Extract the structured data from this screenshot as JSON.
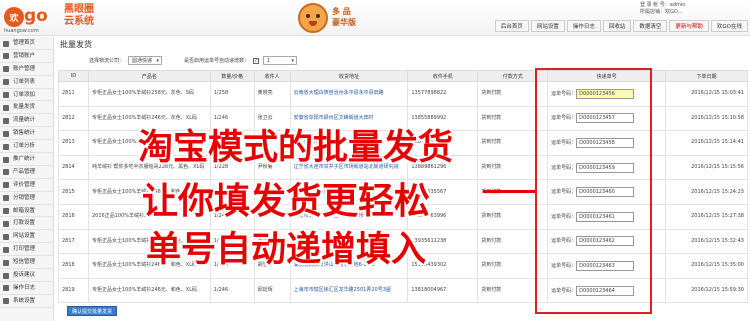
{
  "header": {
    "logo_text": "go",
    "logo_circle": "欢",
    "logo_url": "huangow.com",
    "brand_line1": "黑眼圈",
    "brand_line2": "云系统",
    "edition_line1": "多 品",
    "edition_line2": "豪华版",
    "user_line1": "登 录 帐 号：admin",
    "user_line2": "所属店铺：欢GO...",
    "nav": [
      "后台首页",
      "网站设置",
      "操作日志",
      "回收站",
      "数据清空",
      "更新与帮助",
      "欢GO在线"
    ],
    "nav_active_index": 5
  },
  "sidebar": {
    "items": [
      "管理首页",
      "营销账户",
      "账户管理",
      "订单列表",
      "订单添加",
      "批量发货",
      "流量统计",
      "销售统计",
      "订单分析",
      "推广统计",
      "产品管理",
      "评价管理",
      "分销管理",
      "邮箱设置",
      "打款设置",
      "网站设置",
      "打印管理",
      "短信管理",
      "投诉建议",
      "操作日志",
      "系统设置"
    ]
  },
  "main": {
    "title": "批量发货",
    "filter_carrier_label": "选择物流公司：",
    "filter_carrier_value": "圆通快递",
    "filter_increment_label": "是否启用运单号自动递增数：",
    "filter_increment_checked": "✓",
    "filter_step_value": "1",
    "columns": [
      "ID",
      "产品名",
      "数量/价格",
      "收件人",
      "收货地址",
      "收件手机",
      "付款方式",
      "快递单号",
      "下单日期"
    ],
    "tracking_label": "运单号码：",
    "rows": [
      {
        "id": "2811",
        "product": "专柜正品女士100%羊绒衫258元、灰色、S码",
        "qty": "1/258",
        "name": "黄晓亮",
        "addr": "云南省大理白族自治州永平县永平县旧路",
        "phone": "13577898822",
        "pay": "货到付款",
        "tracking": "D0000123456",
        "date": "2016/12/15 15:03:41"
      },
      {
        "id": "2812",
        "product": "专柜正品女士100%羊绒衫246元、灰色、XL码",
        "qty": "1/246",
        "name": "张卫云",
        "addr": "安徽省阜阳市颍州区文峰街道大田村",
        "phone": "13855889992",
        "pay": "货到付款",
        "tracking": "D0000123457",
        "date": "2016/12/15 15:10:58"
      },
      {
        "id": "2813",
        "product": "专柜正品女士100%羊绒衫246元、酒红",
        "qty": "1/246",
        "name": "陈敏",
        "addr": "广东省广州市天河区龙口东路",
        "phone": "13876663542",
        "pay": "货到付款",
        "tracking": "D0000123458",
        "date": "2016/12/15 15:14:41"
      },
      {
        "id": "2814",
        "product": "纯羊绒衫 帮你多吃半衣服帕哥228元、黑色、XL码",
        "qty": "1/228",
        "name": "尹秋菊",
        "addr": "辽宁省大连市甘井子区市场街道站北街道研究院",
        "phone": "13889861296",
        "pay": "货到付款",
        "tracking": "D0000123459",
        "date": "2016/12/15 15:15:56"
      },
      {
        "id": "2815",
        "product": "专柜正品女士100%羊绒衫246元、和色、XL码",
        "qty": "1/246",
        "name": "吴小平",
        "addr": "河南省郑州市金水区文化路",
        "phone": "13592635567",
        "pay": "货到付款",
        "tracking": "D0000123460",
        "date": "2016/12/15 15:24:23"
      },
      {
        "id": "2816",
        "product": "2016正品100%羊绒衫246元、森红",
        "qty": "1/246",
        "name": "刘英",
        "addr": "北京市北京市朝阳区北影楼链桥",
        "phone": "15810063996",
        "pay": "货到付款",
        "tracking": "D0000123461",
        "date": "2016/12/15 15:27:38"
      },
      {
        "id": "2817",
        "product": "专柜正品女士100%羊绒衫246元、和色、XL码",
        "qty": "1/246",
        "name": "王华",
        "addr": "山西省晋城市沁水县城区大街",
        "phone": "13935611238",
        "pay": "货到付款",
        "tracking": "D0000123462",
        "date": "2016/12/15 15:32:43"
      },
      {
        "id": "2818",
        "product": "专柜正品女士100%羊绒衫246元、和色、XL码",
        "qty": "1/246",
        "name": "胡雪梅",
        "addr": "湖北省武汉市洪山区鲁巷天地6-2-25",
        "phone": "15303439302",
        "pay": "货到付款",
        "tracking": "D0000123463",
        "date": "2016/12/15 15:35:00"
      },
      {
        "id": "2819",
        "product": "专柜正品女士100%羊绒衫246元、和色、XL码",
        "qty": "1/246",
        "name": "邱廷辉",
        "addr": "上海市市辖区徐汇区龙华路2501弄20号3屋",
        "phone": "13818004967",
        "pay": "货到付款",
        "tracking": "D0000123464",
        "date": "2016/12/15 15:59:30"
      }
    ],
    "submit_label": "确认提交批量发货"
  },
  "overlay": {
    "line1": "淘宝模式的批量发货",
    "line2": "让你填发货更轻松",
    "line3": "单号自动递增填入",
    "color": "#e60000"
  }
}
